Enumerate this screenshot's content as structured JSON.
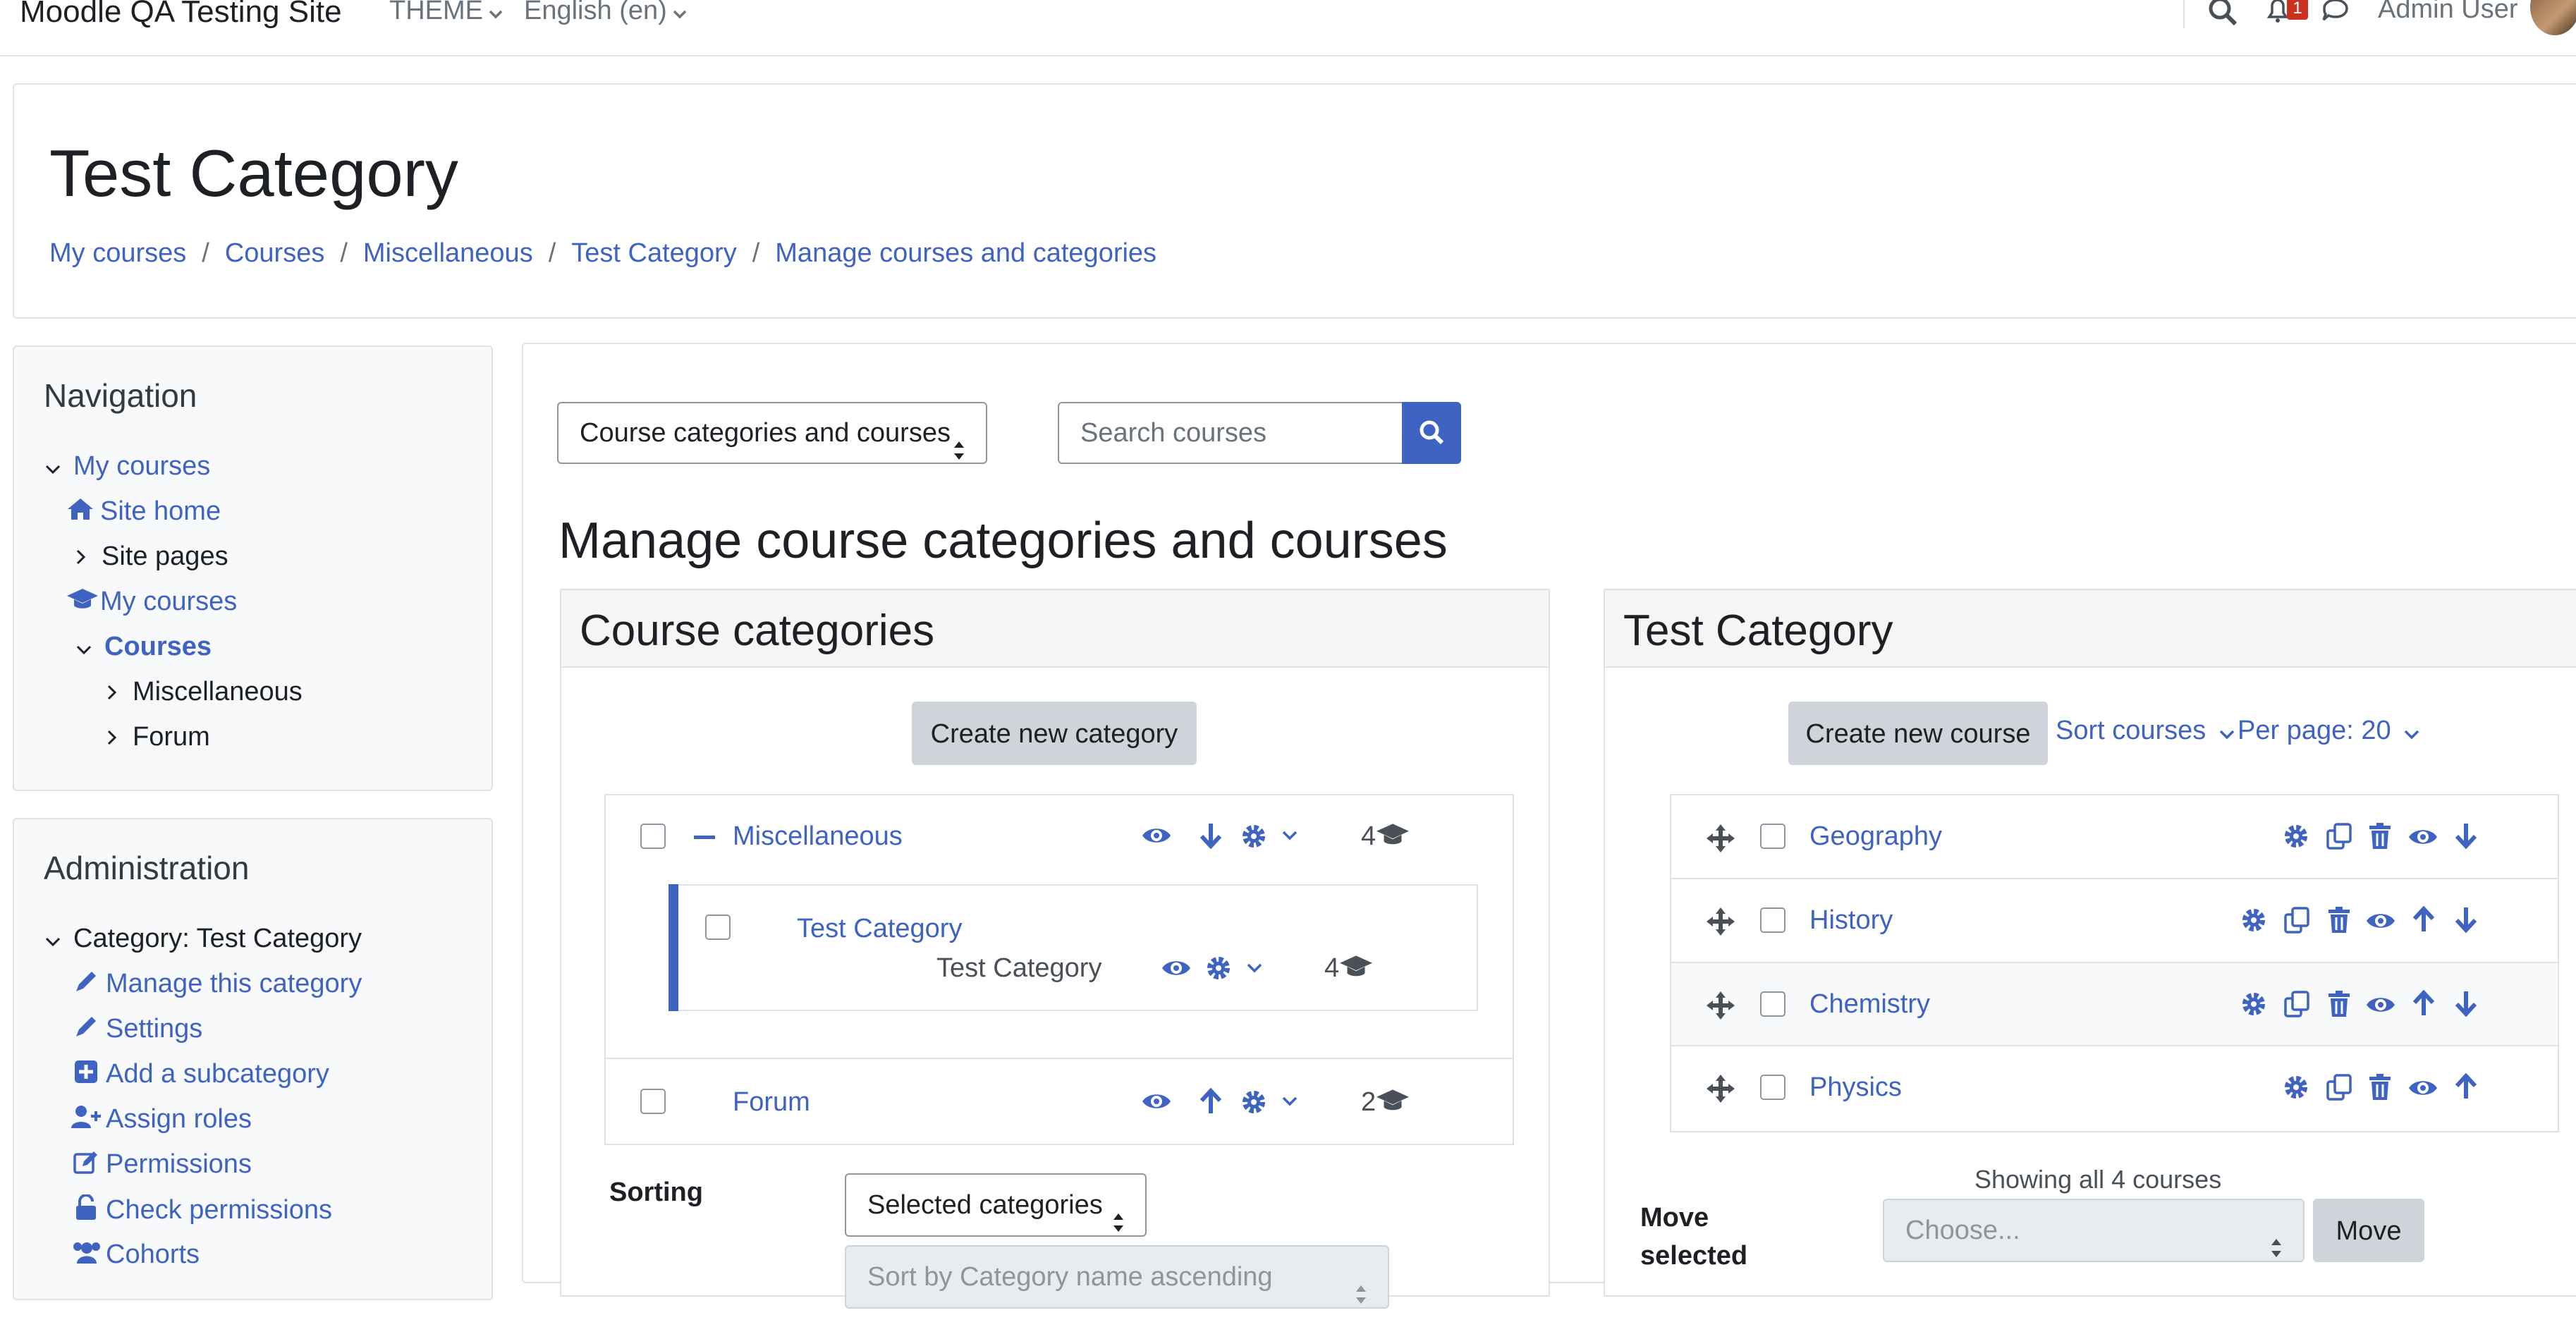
{
  "navbar": {
    "brand": "Moodle QA Testing Site",
    "theme_menu": "THEME",
    "language_menu": "English (en)",
    "notification_count": "1",
    "user_name": "Admin User"
  },
  "header": {
    "title": "Test Category",
    "breadcrumb": [
      "My courses",
      "Courses",
      "Miscellaneous",
      "Test Category",
      "Manage courses and categories"
    ]
  },
  "navigation_block": {
    "title": "Navigation",
    "items": [
      "My courses",
      "Site home",
      "Site pages",
      "My courses",
      "Courses",
      "Miscellaneous",
      "Forum"
    ]
  },
  "administration_block": {
    "title": "Administration",
    "category_label": "Category: Test Category",
    "items": [
      "Manage this category",
      "Settings",
      "Add a subcategory",
      "Assign roles",
      "Permissions",
      "Check permissions",
      "Cohorts"
    ]
  },
  "main": {
    "view_select": "Course categories and courses",
    "search_placeholder": "Search courses",
    "heading": "Manage course categories and courses"
  },
  "categories_panel": {
    "title": "Course categories",
    "create_button": "Create new category",
    "rows": [
      {
        "name": "Miscellaneous",
        "count": "4"
      },
      {
        "name": "Test Category",
        "subtitle": "Test Category",
        "count": "4"
      },
      {
        "name": "Forum",
        "count": "2"
      }
    ],
    "sorting_label": "Sorting",
    "sorting_select": "Selected categories",
    "sort_by_select": "Sort by Category name ascending"
  },
  "courses_panel": {
    "title": "Test Category",
    "create_button": "Create new course",
    "sort_menu": "Sort courses",
    "per_page_menu": "Per page: 20",
    "courses": [
      "Geography",
      "History",
      "Chemistry",
      "Physics"
    ],
    "showing_text": "Showing all 4 courses",
    "move_label_1": "Move",
    "move_label_2": "selected",
    "move_select_placeholder": "Choose...",
    "move_button": "Move"
  },
  "colors": {
    "link": "#3f63c0",
    "primary": "#3f63c0",
    "border": "#dee2e6",
    "badge": "#ca3120"
  }
}
